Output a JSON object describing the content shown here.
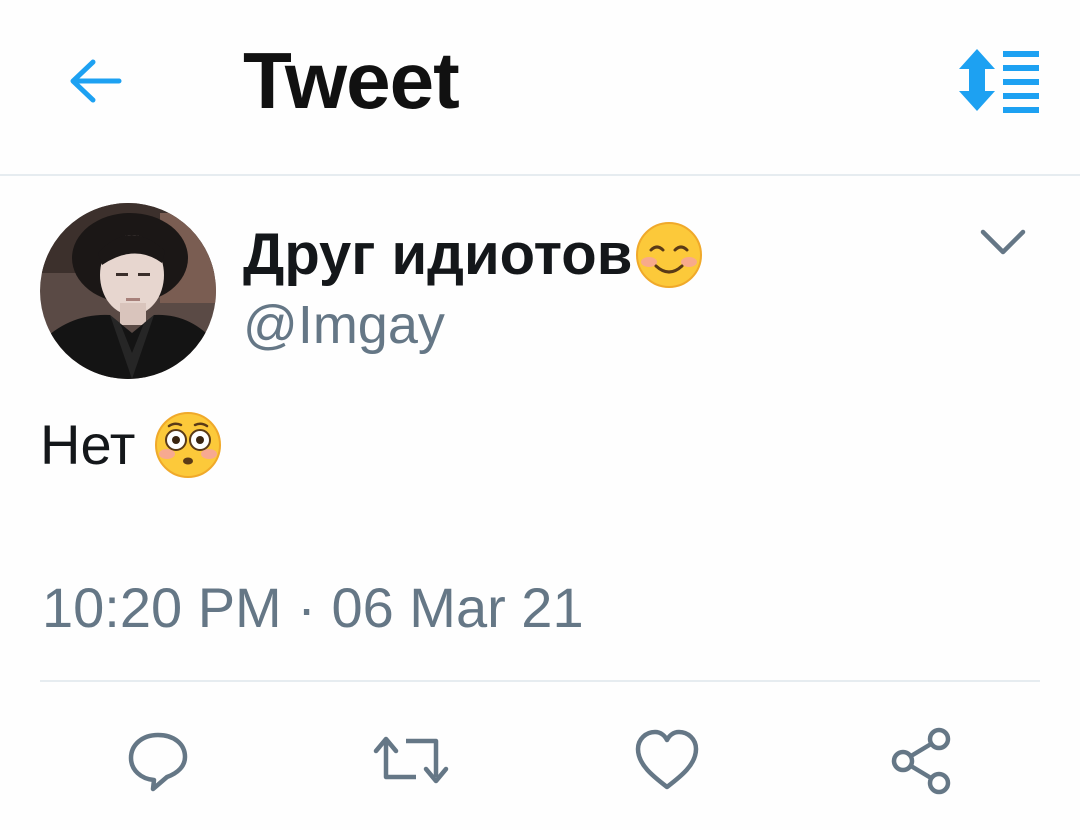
{
  "header": {
    "title": "Tweet",
    "back_icon": "arrow-left-icon",
    "sort_icon": "sort-list-icon",
    "accent_color": "#1da1f2"
  },
  "tweet": {
    "display_name": "Друг идиотов",
    "display_name_emoji": "smiling-face-icon",
    "handle": "@Imgay",
    "text": "Нет",
    "text_emoji": "flushed-face-icon",
    "timestamp": "10:20 PM · 06 Mar 21",
    "text_color": "#14171a",
    "secondary_color": "#657786"
  },
  "actions": [
    {
      "name": "reply-icon"
    },
    {
      "name": "retweet-icon"
    },
    {
      "name": "like-icon"
    },
    {
      "name": "share-icon"
    }
  ]
}
